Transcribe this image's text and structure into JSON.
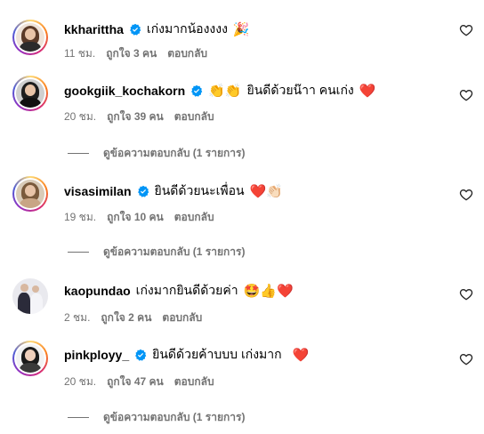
{
  "colors": {
    "verified": "#0095f6",
    "meta": "#737373",
    "heart_emoji": "#e0245e"
  },
  "comments": [
    {
      "username": "kkharittha",
      "text": "เก่งมากน้องงงง",
      "emoji": "🎉",
      "time": "11 ชม.",
      "likes": "ถูกใจ 3 คน",
      "reply": "ตอบกลับ",
      "replies_label": ""
    },
    {
      "username": "gookgiik_kochakorn",
      "emoji_pre": "👏👏",
      "text": "ยินดีด้วยน๊าา คนเก่ง",
      "emoji": "❤️",
      "time": "20 ชม.",
      "likes": "ถูกใจ 39 คน",
      "reply": "ตอบกลับ",
      "replies_label": "ดูข้อความตอบกลับ (1 รายการ)"
    },
    {
      "username": "visasimilan",
      "text": "ยินดีด้วยนะเพื่อน",
      "emoji": "❤️👏🏻",
      "time": "19 ชม.",
      "likes": "ถูกใจ 10 คน",
      "reply": "ตอบกลับ",
      "replies_label": "ดูข้อความตอบกลับ (1 รายการ)"
    },
    {
      "username": "kaopundao",
      "text": "เก่งมากยินดีด้วยค่า",
      "emoji": "🤩👍❤️",
      "time": "2 ชม.",
      "likes": "ถูกใจ 2 คน",
      "reply": "ตอบกลับ",
      "replies_label": ""
    },
    {
      "username": "pinkployy_",
      "text": "ยินดีด้วยค้าบบบ เก่งมาก",
      "emoji": "❤️",
      "time": "20 ชม.",
      "likes": "ถูกใจ 47 คน",
      "reply": "ตอบกลับ",
      "replies_label": "ดูข้อความตอบกลับ (1 รายการ)"
    }
  ]
}
